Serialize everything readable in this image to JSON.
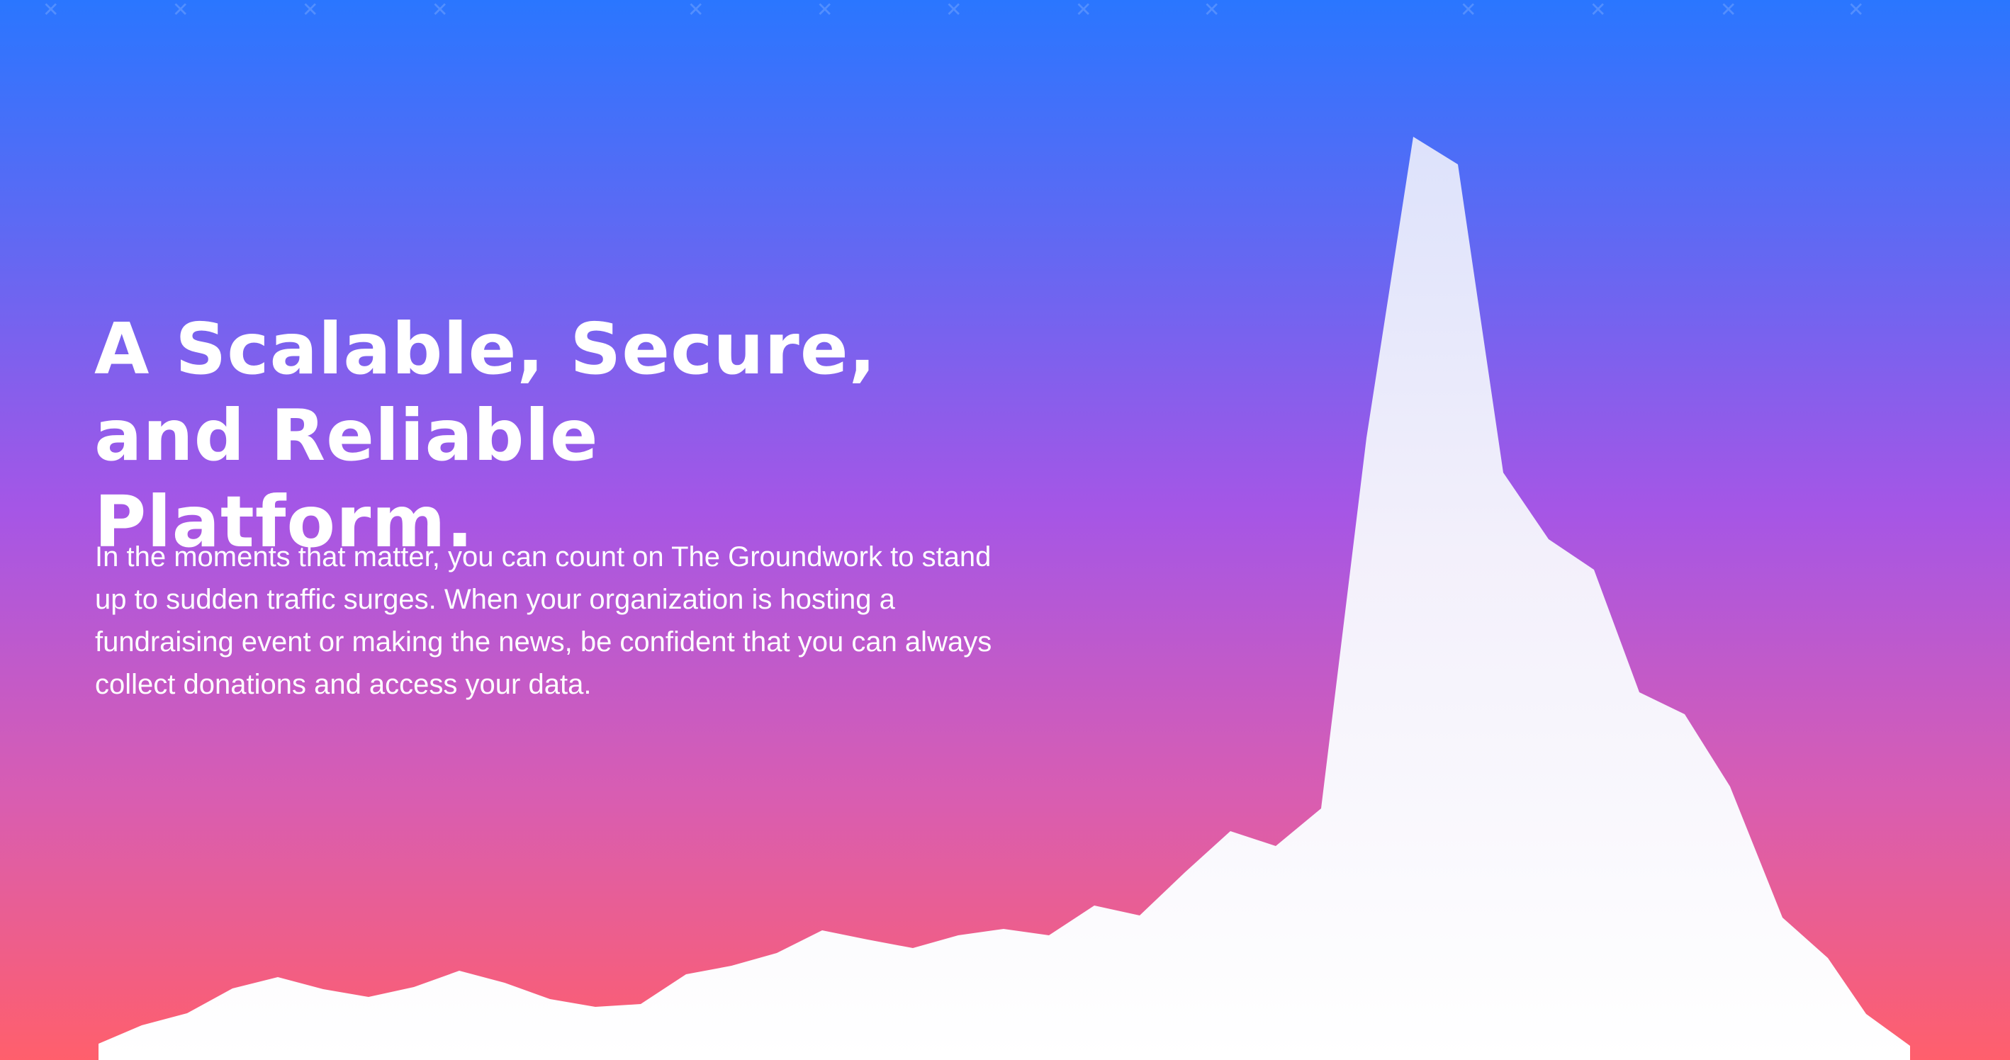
{
  "hero": {
    "headline": "A Scalable, Secure, and Reliable Platform.",
    "body": "In the moments that matter, you can count on The Groundwork to stand up to sudden traffic surges. When your organization is hosting a fundraising event or making the news, be confident that you can always collect donations and access your data."
  },
  "colors": {
    "gradient_top": "#2a76ff",
    "gradient_mid": "#a556e6",
    "gradient_bottom": "#ff5f6c",
    "text": "#ffffff",
    "chart_fill": "#ffffff"
  },
  "decor": {
    "spark_glyph": "✕"
  }
}
